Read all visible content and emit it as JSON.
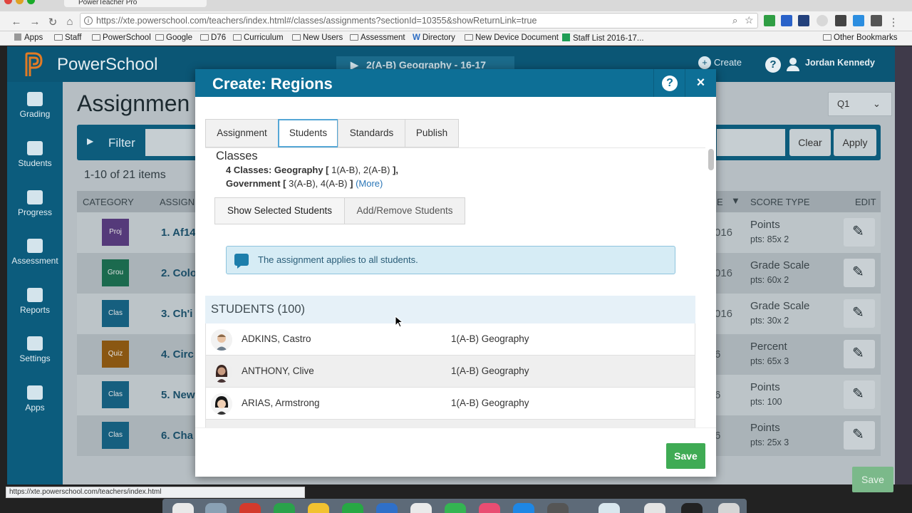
{
  "browser": {
    "tab_title": "PowerTeacher Pro",
    "url": "https://xte.powerschool.com/teachers/index.html#/classes/assignments?sectionId=10355&showReturnLink=true",
    "bookmarks": [
      "Apps",
      "Staff",
      "PowerSchool",
      "Google",
      "D76",
      "Curriculum",
      "New Users",
      "Assessment",
      "Directory",
      "New Device Document",
      "Staff List 2016-17...",
      "Other Bookmarks"
    ],
    "status_url": "https://xte.powerschool.com/teachers/index.html"
  },
  "ps": {
    "logo": "PowerSchool",
    "class_selector": "2(A-B) Geography - 16-17",
    "create_label": "Create",
    "help": "?",
    "user": "Jordan Kennedy",
    "sidebar": [
      {
        "label": "Grading",
        "icon": "grading-icon"
      },
      {
        "label": "Students",
        "icon": "students-icon"
      },
      {
        "label": "Progress",
        "icon": "progress-icon"
      },
      {
        "label": "Assessment",
        "icon": "assessment-icon"
      },
      {
        "label": "Reports",
        "icon": "reports-icon"
      },
      {
        "label": "Settings",
        "icon": "settings-icon"
      },
      {
        "label": "Apps",
        "icon": "apps-icon"
      }
    ],
    "page_title": "Assignmen",
    "term": "Q1",
    "filter_label": "Filter",
    "clear_label": "Clear",
    "apply_label": "Apply",
    "count": "1-10 of 21 items",
    "columns": {
      "category": "CATEGORY",
      "assignment": "ASSIGN",
      "due": "E",
      "score_type": "SCORE TYPE",
      "edit": "EDIT"
    },
    "rows": [
      {
        "cat": "Proj",
        "title": "1. Af14",
        "date": "016",
        "type": "Points",
        "pts": "pts: 85x 2"
      },
      {
        "cat": "Grou",
        "title": "2. Colo",
        "date": "016",
        "type": "Grade Scale",
        "pts": "pts: 60x 2"
      },
      {
        "cat": "Clas",
        "title": "3. Ch'i",
        "date": "016",
        "type": "Grade Scale",
        "pts": "pts: 30x 2"
      },
      {
        "cat": "Quiz",
        "title": "4. Circ",
        "date": "6",
        "type": "Percent",
        "pts": "pts: 65x 3"
      },
      {
        "cat": "Clas",
        "title": "5. New",
        "date": "6",
        "type": "Points",
        "pts": "pts: 100"
      },
      {
        "cat": "Clas",
        "title": "6. Cha",
        "date": "6",
        "type": "Points",
        "pts": "pts: 25x 3"
      }
    ],
    "save_label": "Save"
  },
  "modal": {
    "title": "Create: Regions",
    "help": "?",
    "close": "×",
    "tabs": [
      "Assignment",
      "Students",
      "Standards",
      "Publish"
    ],
    "classes_label": "Classes",
    "classes_line1_bold": "4 Classes: Geography [",
    "classes_line1_rest": " 1(A-B), 2(A-B) ",
    "classes_line1_end": "],",
    "classes_line2_bold": "Government [",
    "classes_line2_rest": " 3(A-B), 4(A-B) ",
    "classes_line2_end": "]",
    "more_link": "(More)",
    "seg_show": "Show Selected Students",
    "seg_add": "Add/Remove Students",
    "info_text": "The assignment applies to all students.",
    "students_header": "STUDENTS (100)",
    "students": [
      {
        "name": "ADKINS, Castro",
        "class": "1(A-B) Geography"
      },
      {
        "name": "ANTHONY, Clive",
        "class": "1(A-B) Geography"
      },
      {
        "name": "ARIAS, Armstrong",
        "class": "1(A-B) Geography"
      }
    ],
    "save": "Save"
  }
}
